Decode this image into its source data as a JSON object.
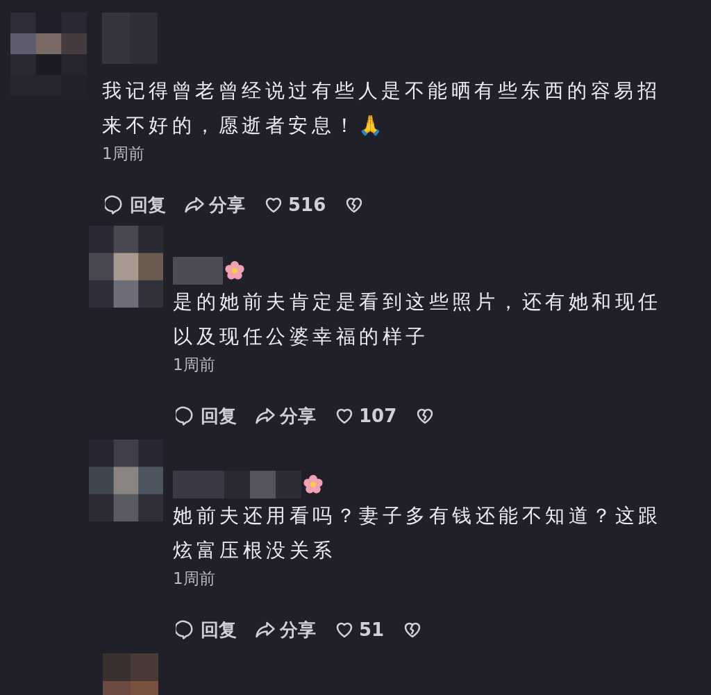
{
  "comments": [
    {
      "flower_badge": false,
      "text": "我记得曾老曾经说过有些人是不能晒有些东西的容易招来不好的，愿逝者安息！🙏",
      "time": "1周前",
      "reply_label": "回复",
      "share_label": "分享",
      "likes": "516",
      "children": [
        {
          "flower_badge": true,
          "text": "是的她前夫肯定是看到这些照片，还有她和现任以及现任公婆幸福的样子",
          "time": "1周前",
          "reply_label": "回复",
          "share_label": "分享",
          "likes": "107"
        },
        {
          "flower_badge": true,
          "text": "她前夫还用看吗？妻子多有钱还能不知道？这跟炫富压根没关系",
          "time": "1周前",
          "reply_label": "回复",
          "share_label": "分享",
          "likes": "51"
        }
      ]
    }
  ]
}
